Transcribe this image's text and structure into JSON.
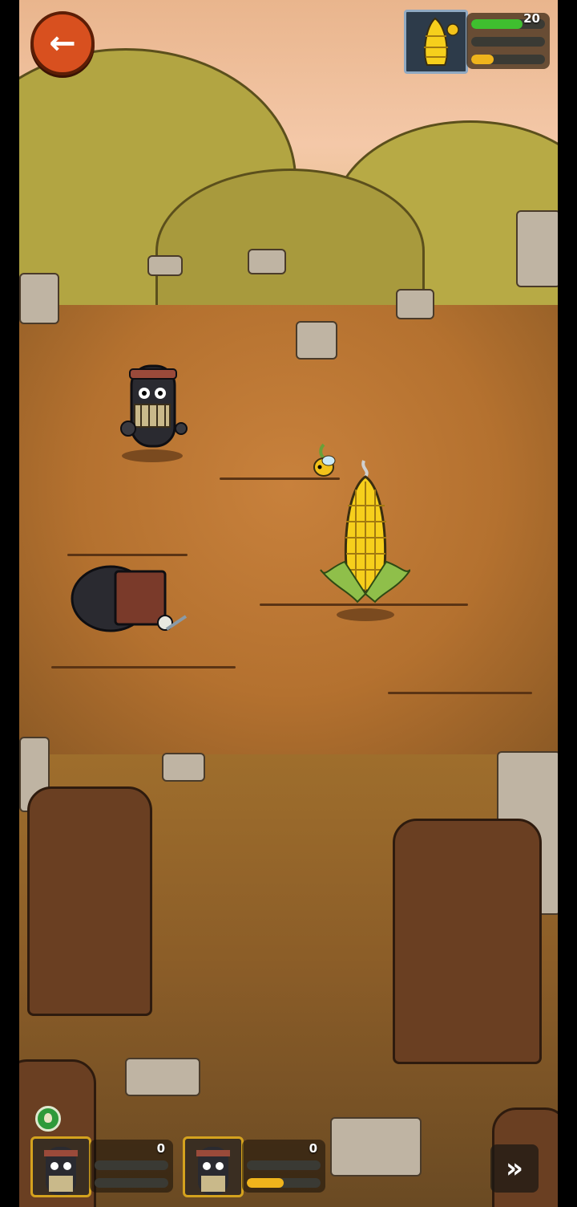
{
  "hud": {
    "back_icon": "back-arrow-icon",
    "boss": {
      "portrait": "corn-boss-portrait",
      "hp_value": "20",
      "hp_fraction": 0.7,
      "shield_fraction": 0.0,
      "energy_fraction": 0.3,
      "hp_color": "#3fbf2f",
      "energy_color": "#f0b41c"
    }
  },
  "units": [
    {
      "portrait": "warrior-portrait",
      "count": "0",
      "hp_fraction": 0.0,
      "energy_fraction": 0.0
    },
    {
      "portrait": "warrior-portrait",
      "count": "0",
      "hp_fraction": 0.0,
      "energy_fraction": 0.5
    }
  ],
  "controls": {
    "fast_forward_icon": "fast-forward-icon",
    "badge_icon": "seed-badge-icon"
  },
  "colors": {
    "accent_orange": "#d8501f",
    "gold_border": "#d4a21e",
    "bar_yellow": "#f0b41c",
    "bar_green": "#3fbf2f"
  }
}
